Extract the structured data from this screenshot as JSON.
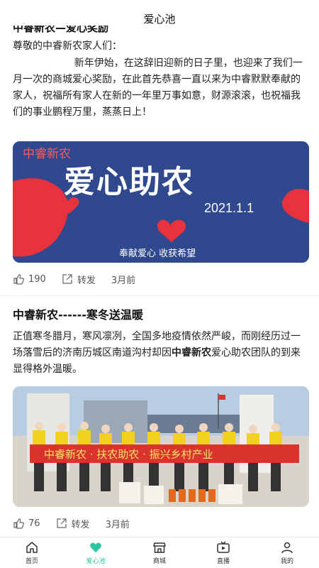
{
  "header": {
    "title": "爱心池"
  },
  "post1": {
    "title_partial": "中睿新农—爱心奖励",
    "salutation": "尊敬的中睿新农家人们：",
    "body": "新年伊始，在这辞旧迎新的日子里，也迎来了我们一月一次的商城爱心奖励，在此首先恭喜一直以来为中睿默默奉献的家人，祝福所有家人在新的一年里万事如意，财源滚滚，也祝福我们的事业鹏程万里，蒸蒸日上！",
    "banner": {
      "brand": "中睿新农",
      "headline": "爱心助农",
      "date": "2021.1.1",
      "slogan": "奉献爱心  收获希望"
    },
    "likes": "190",
    "share_label": "转发",
    "time": "3月前"
  },
  "post2": {
    "title": "中睿新农------寒冬送温暖",
    "text_before": "正值寒冬腊月，寒风凛冽，全国多地疫情依然严峻，而刚经历过一场落雪后的济南历城区南道沟村却因",
    "text_bold": "中睿新农",
    "text_after": "爱心助农团队的到来显得格外温暖。",
    "photo_banner_text": "中睿新农 · 扶农助农 · 振兴乡村产业",
    "likes": "76",
    "share_label": "转发",
    "time": "3月前"
  },
  "tabbar": {
    "items": [
      {
        "label": "首页",
        "icon": "home-icon"
      },
      {
        "label": "爱心池",
        "icon": "heart-icon",
        "active": true
      },
      {
        "label": "商城",
        "icon": "store-icon"
      },
      {
        "label": "直播",
        "icon": "live-icon"
      },
      {
        "label": "我的",
        "icon": "user-icon"
      }
    ]
  },
  "colors": {
    "accent": "#29c4a0",
    "banner_bg": "#2f4a8f",
    "heart": "#e8333f",
    "photo_banner": "#d9342b"
  }
}
